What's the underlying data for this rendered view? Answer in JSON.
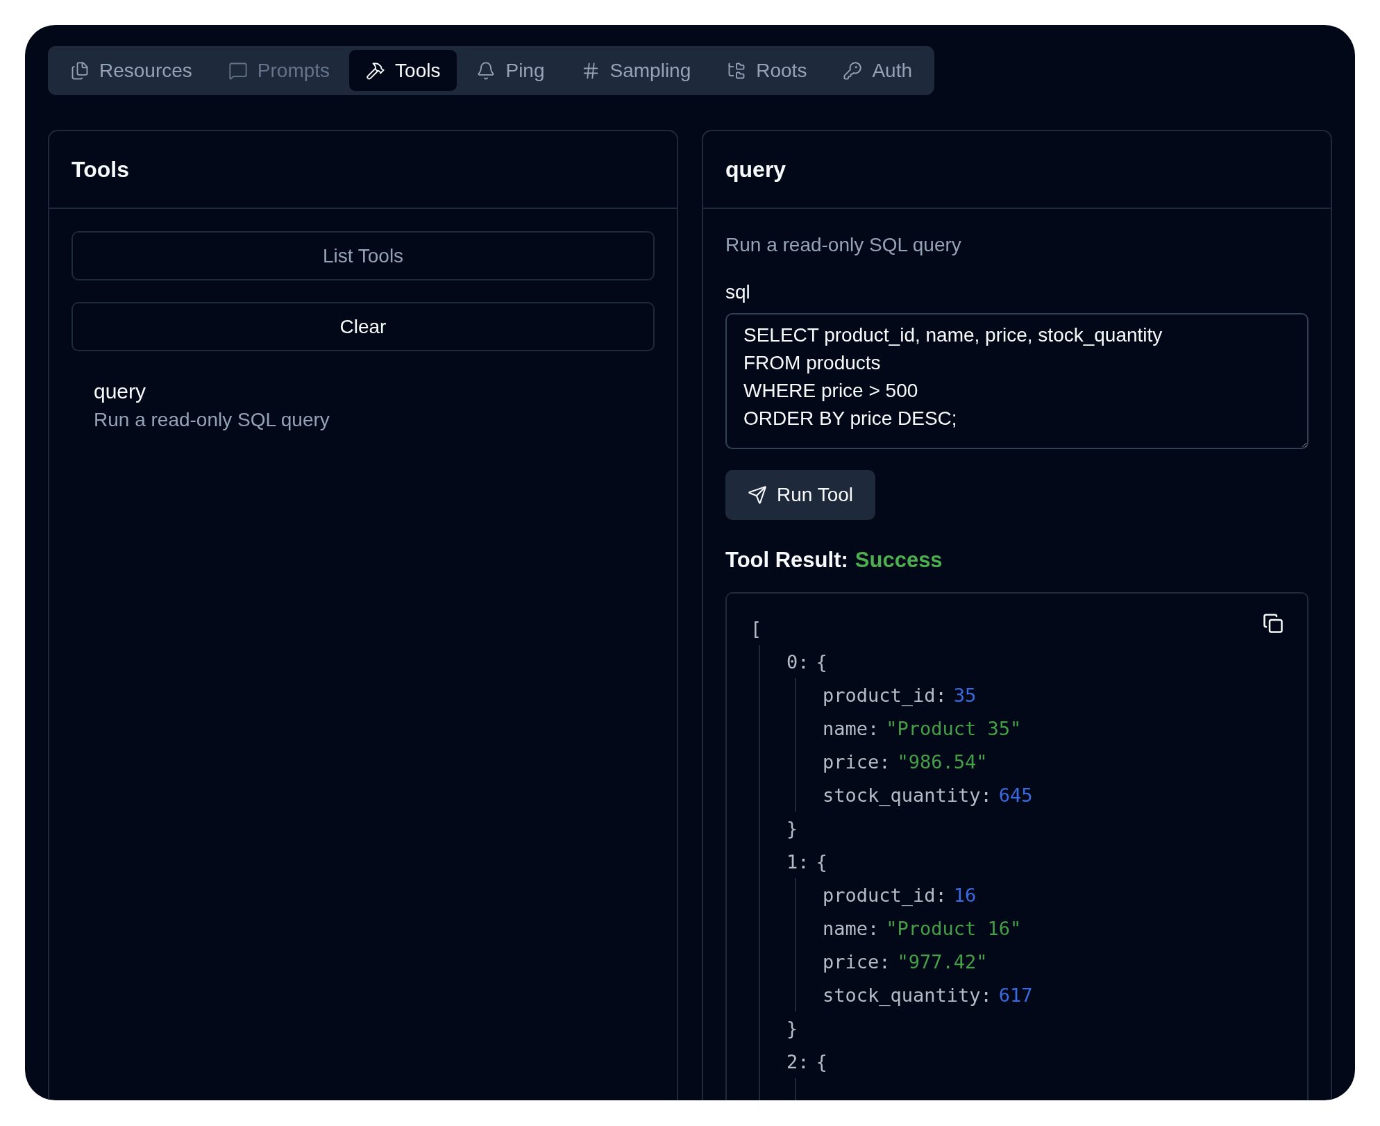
{
  "tabs": [
    {
      "label": "Resources",
      "selected": false,
      "disabled": false
    },
    {
      "label": "Prompts",
      "selected": false,
      "disabled": true
    },
    {
      "label": "Tools",
      "selected": true,
      "disabled": false
    },
    {
      "label": "Ping",
      "selected": false,
      "disabled": false
    },
    {
      "label": "Sampling",
      "selected": false,
      "disabled": false
    },
    {
      "label": "Roots",
      "selected": false,
      "disabled": false
    },
    {
      "label": "Auth",
      "selected": false,
      "disabled": false
    }
  ],
  "tools_panel": {
    "title": "Tools",
    "buttons": [
      {
        "label": "List Tools",
        "disabled": true
      },
      {
        "label": "Clear",
        "disabled": false
      }
    ],
    "items": [
      {
        "name": "query",
        "description": "Run a read-only SQL query"
      }
    ]
  },
  "detail_panel": {
    "title": "query",
    "description": "Run a read-only SQL query",
    "field": {
      "label": "sql",
      "value": "SELECT product_id, name, price, stock_quantity\nFROM products\nWHERE price > 500\nORDER BY price DESC;"
    },
    "run_button": "Run Tool",
    "result_label": "Tool Result:",
    "result_status": "Success",
    "result": {
      "open": "[",
      "items": [
        {
          "label": "0:",
          "open": "{",
          "close": "}",
          "fields": [
            {
              "key": "product_id:",
              "value": "35",
              "kind": "number"
            },
            {
              "key": "name:",
              "value": "\"Product 35\"",
              "kind": "string"
            },
            {
              "key": "price:",
              "value": "\"986.54\"",
              "kind": "string"
            },
            {
              "key": "stock_quantity:",
              "value": "645",
              "kind": "number"
            }
          ]
        },
        {
          "label": "1:",
          "open": "{",
          "close": "}",
          "fields": [
            {
              "key": "product_id:",
              "value": "16",
              "kind": "number"
            },
            {
              "key": "name:",
              "value": "\"Product 16\"",
              "kind": "string"
            },
            {
              "key": "price:",
              "value": "\"977.42\"",
              "kind": "string"
            },
            {
              "key": "stock_quantity:",
              "value": "617",
              "kind": "number"
            }
          ]
        },
        {
          "label": "2:",
          "open": "{"
        }
      ]
    }
  }
}
